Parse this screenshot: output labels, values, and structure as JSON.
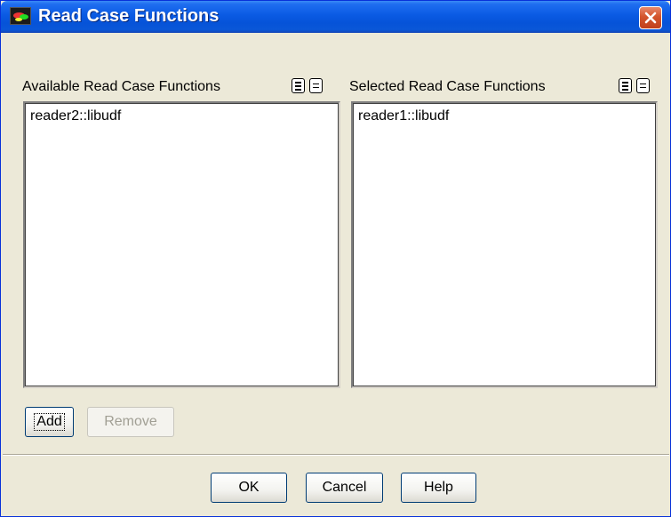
{
  "window": {
    "title": "Read Case Functions"
  },
  "available": {
    "label": "Available Read Case Functions",
    "items": [
      "reader2::libudf"
    ]
  },
  "selected": {
    "label": "Selected Read Case Functions",
    "items": [
      "reader1::libudf"
    ]
  },
  "actions": {
    "add_label": "Add",
    "remove_label": "Remove"
  },
  "footer": {
    "ok_label": "OK",
    "cancel_label": "Cancel",
    "help_label": "Help"
  }
}
